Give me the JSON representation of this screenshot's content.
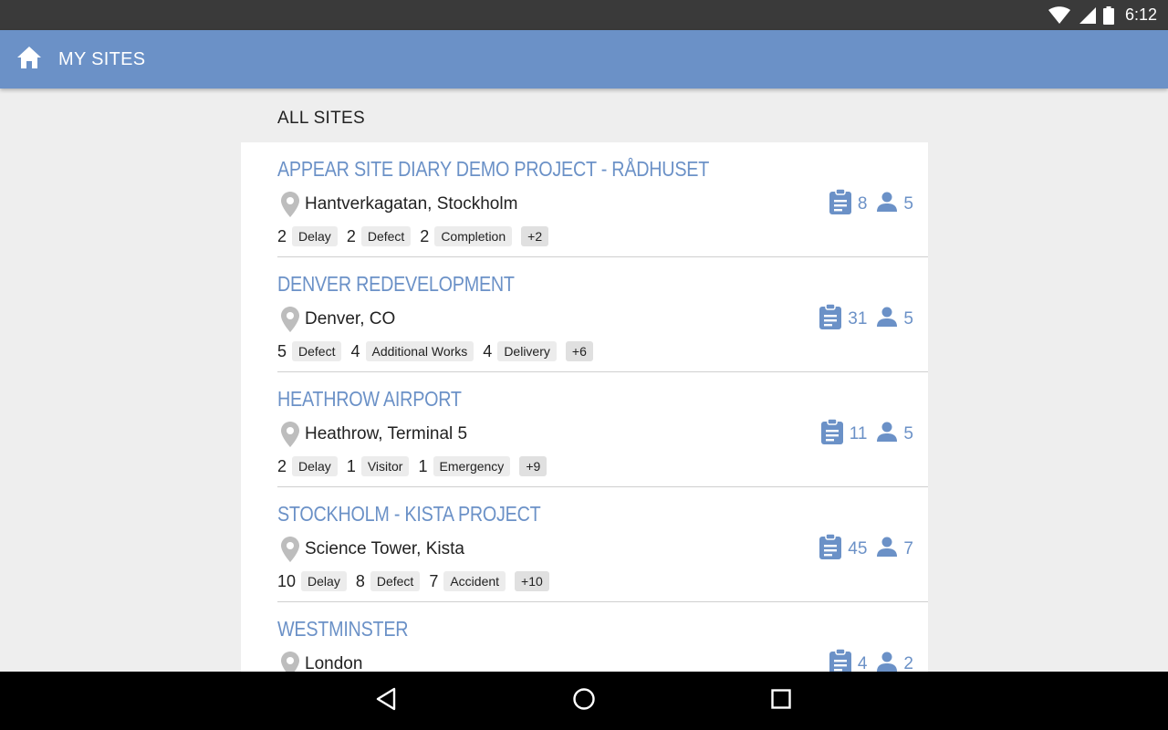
{
  "status_bar": {
    "time": "6:12",
    "icons": [
      "wifi-icon",
      "signal-icon",
      "battery-icon"
    ]
  },
  "app_bar": {
    "title": "MY SITES",
    "icon": "home-icon"
  },
  "section_title": "ALL SITES",
  "colors": {
    "accent": "#6b91c7",
    "status_bar": "#3a3a3a",
    "background": "#eeeeee",
    "tag_bg": "#ececec"
  },
  "sites": [
    {
      "title": "APPEAR SITE DIARY DEMO PROJECT - RÅDHUSET",
      "location": "Hantverkagatan, Stockholm",
      "reports": "8",
      "members": "5",
      "tags": [
        {
          "count": "2",
          "label": "Delay"
        },
        {
          "count": "2",
          "label": "Defect"
        },
        {
          "count": "2",
          "label": "Completion"
        }
      ],
      "more": "+2"
    },
    {
      "title": "DENVER REDEVELOPMENT",
      "location": "Denver, CO",
      "reports": "31",
      "members": "5",
      "tags": [
        {
          "count": "5",
          "label": "Defect"
        },
        {
          "count": "4",
          "label": "Additional Works"
        },
        {
          "count": "4",
          "label": "Delivery"
        }
      ],
      "more": "+6"
    },
    {
      "title": "HEATHROW AIRPORT",
      "location": "Heathrow, Terminal 5",
      "reports": "11",
      "members": "5",
      "tags": [
        {
          "count": "2",
          "label": "Delay"
        },
        {
          "count": "1",
          "label": "Visitor"
        },
        {
          "count": "1",
          "label": "Emergency"
        }
      ],
      "more": "+9"
    },
    {
      "title": "STOCKHOLM - KISTA PROJECT",
      "location": "Science Tower, Kista",
      "reports": "45",
      "members": "7",
      "tags": [
        {
          "count": "10",
          "label": "Delay"
        },
        {
          "count": "8",
          "label": "Defect"
        },
        {
          "count": "7",
          "label": "Accident"
        }
      ],
      "more": "+10"
    },
    {
      "title": "WESTMINSTER",
      "location": "London",
      "reports": "4",
      "members": "2",
      "tags": [],
      "more": ""
    }
  ],
  "nav_bar": {
    "buttons": [
      "back-icon",
      "home-circle-icon",
      "recents-icon"
    ]
  }
}
